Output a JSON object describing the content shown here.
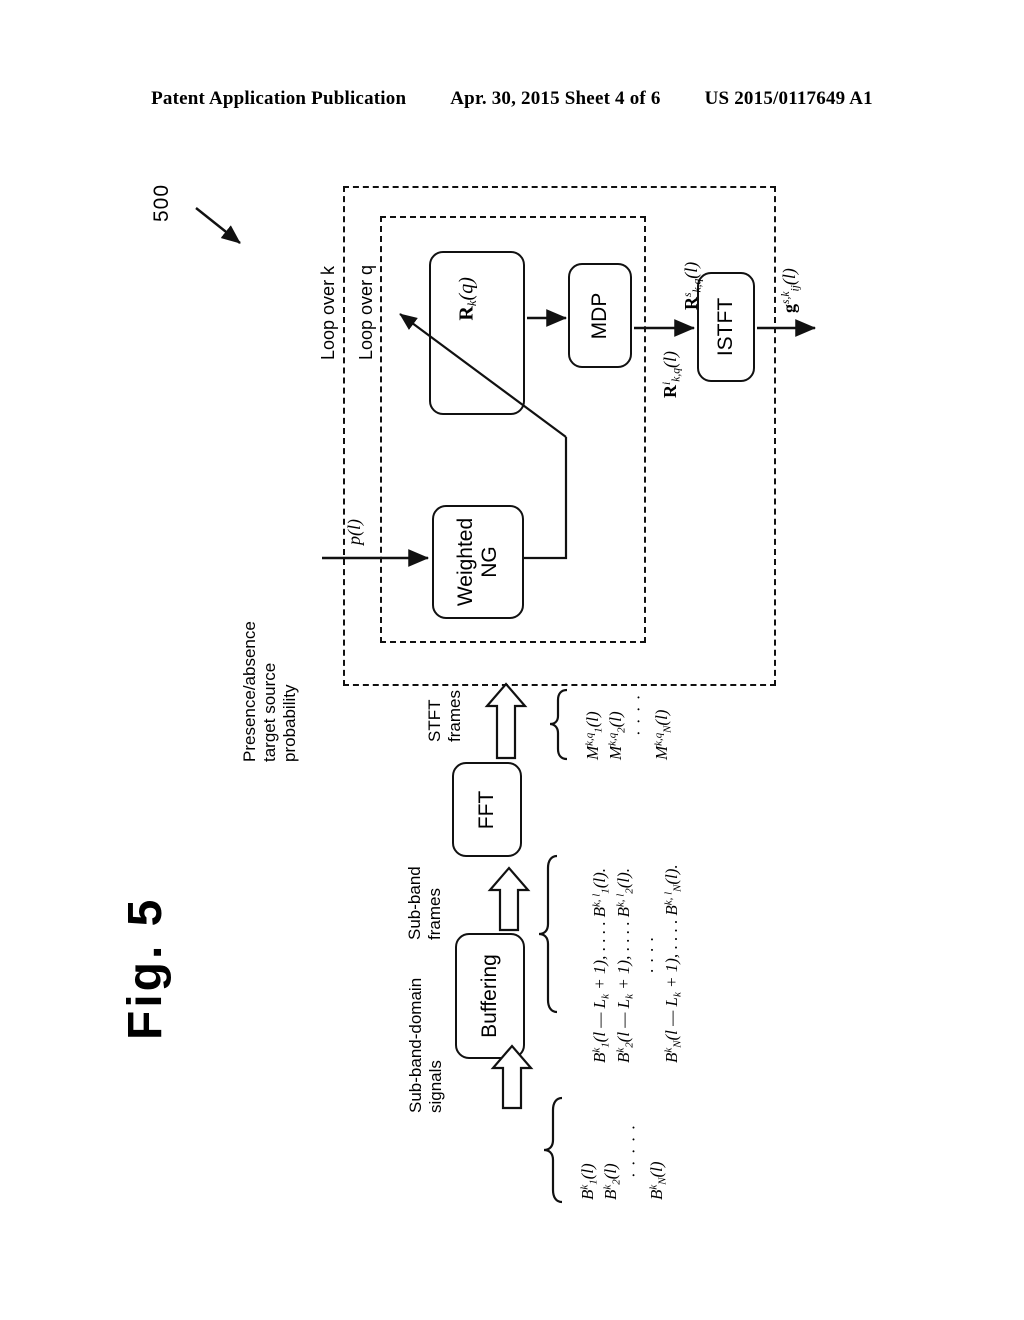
{
  "header": {
    "left": "Patent Application Publication",
    "middle": "Apr. 30, 2015  Sheet 4 of 6",
    "right": "US 2015/0117649 A1"
  },
  "figure": {
    "label": "Fig. 5",
    "reference_numeral": "500"
  },
  "loops": {
    "outer_label": "Loop over k",
    "inner_label": "Loop over q"
  },
  "blocks": {
    "correlation": "R_k(q)",
    "mdp": "MDP",
    "istft": "ISTFT",
    "weighted_ng": "Weighted\nNG",
    "fft": "FFT",
    "buffering": "Buffering"
  },
  "annotations": {
    "presence_probability": "Presence/absence\ntarget source\nprobability",
    "stft_frames": "STFT\nframes",
    "subband_frames": "Sub-band\nframes",
    "subband_domain_signals": "Sub-band-domain\nsignals"
  },
  "signals": {
    "probability_input": {
      "base": "p",
      "arg": "(l)"
    },
    "mdp_input": {
      "bold": "R",
      "sup": "i",
      "sub": "k,q",
      "arg": "(l)"
    },
    "mdp_output": {
      "bold": "R",
      "sup": "s",
      "sub": "k,q",
      "arg": "(l)"
    },
    "istft_output": {
      "bold": "g",
      "sup": "s,k",
      "sub": "ij",
      "arg": "(l)"
    }
  },
  "stft_frame_list": [
    {
      "base": "M",
      "sub": "1",
      "sup": "k,q",
      "arg": "(l)"
    },
    {
      "base": "M",
      "sub": "2",
      "sup": "k,q",
      "arg": "(l)"
    },
    {
      "ellipsis": "· · · ·"
    },
    {
      "base": "M",
      "sub": "N",
      "sup": "k,q",
      "arg": "(l)"
    }
  ],
  "subband_frame_list": [
    {
      "base": "B",
      "sub": "1",
      "sup": "k",
      "arg": "(l — L",
      "argsub": "k",
      "argtail": " + 1),",
      "ellipsis": " . . . . ",
      "tail_base": "B",
      "tail_sub": "1",
      "tail_sup": "k, l",
      "tail_arg": "(l)."
    },
    {
      "base": "B",
      "sub": "2",
      "sup": "k",
      "arg": "(l — L",
      "argsub": "k",
      "argtail": " + 1),",
      "ellipsis": " . . . . ",
      "tail_base": "B",
      "tail_sub": "2",
      "tail_sup": "k, l",
      "tail_arg": "(l)."
    },
    {
      "ellipsis": " . . . . "
    },
    {
      "base": "B",
      "sub": "N",
      "sup": "k",
      "arg": "(l — L",
      "argsub": "k",
      "argtail": " + 1),",
      "ellipsis": " . . . . ",
      "tail_base": "B",
      "tail_sub": "N",
      "tail_sup": "k, l",
      "tail_arg": "(l)."
    }
  ],
  "subband_signal_list": [
    {
      "base": "B",
      "sub": "1",
      "sup": "k",
      "arg": "(l)"
    },
    {
      "base": "B",
      "sub": "2",
      "sup": "k",
      "arg": "(l)"
    },
    {
      "ellipsis": "· · · · ·"
    },
    {
      "base": "B",
      "sub": "N",
      "sup": "k",
      "arg": "(l)"
    }
  ],
  "colors": {
    "ink": "#111111",
    "paper": "#ffffff"
  }
}
